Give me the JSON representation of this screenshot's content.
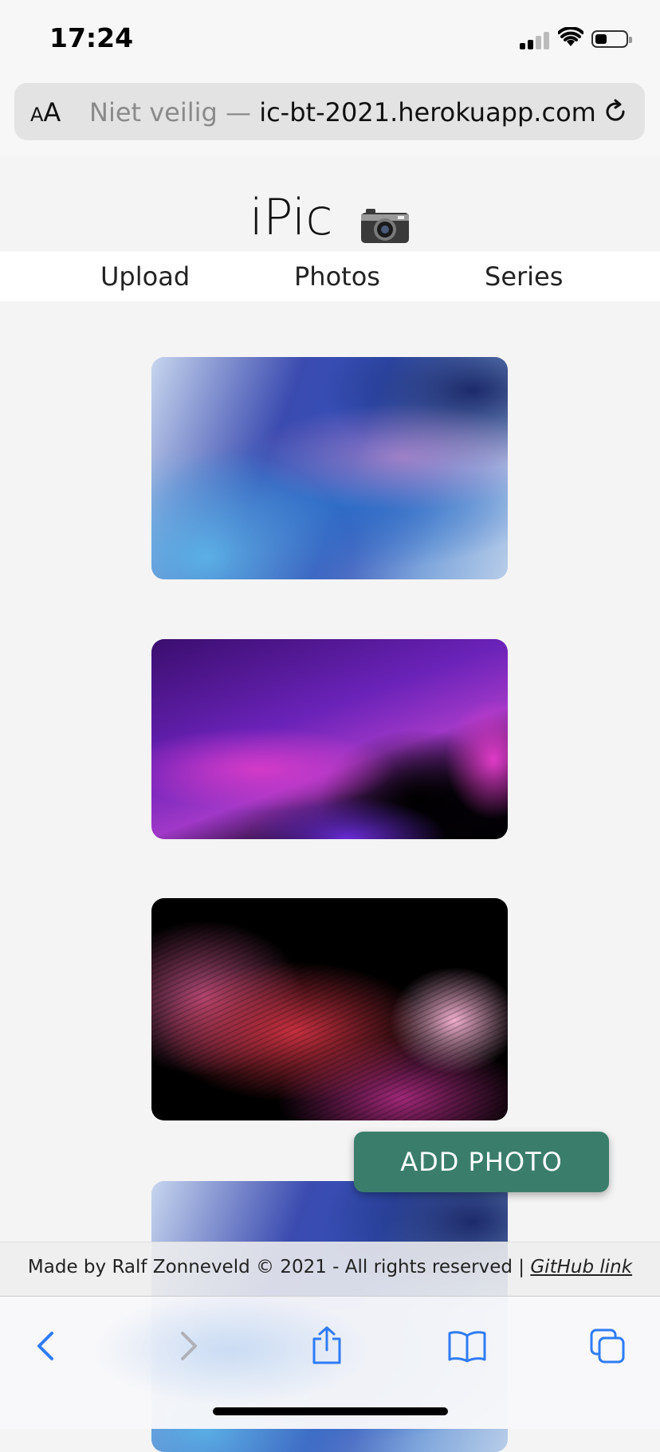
{
  "status_bar": {
    "time": "17:24",
    "battery_level": 0.4
  },
  "browser": {
    "text_size_button": "AA",
    "url_insecure_label": "Niet veilig — ",
    "url_host": "ic-bt-2021.herokuapp.com"
  },
  "site": {
    "title": "iPic",
    "nav": [
      {
        "label": "Upload"
      },
      {
        "label": "Photos"
      },
      {
        "label": "Series"
      }
    ]
  },
  "photos": [
    {
      "name": "blue-silk-wallpaper"
    },
    {
      "name": "purple-waves-wallpaper"
    },
    {
      "name": "red-flow-wallpaper"
    },
    {
      "name": "blue-silk-wallpaper"
    }
  ],
  "add_photo_button": "ADD PHOTO",
  "footer": {
    "text": "Made by Ralf Zonneveld © 2021 - All rights reserved | ",
    "link": "GitHub link"
  },
  "toolbar": {
    "icons": [
      "back-icon",
      "forward-icon",
      "share-icon",
      "bookmarks-icon",
      "tabs-icon"
    ]
  },
  "colors": {
    "accent": "#3b7d6b",
    "link_blue": "#2f7bf5"
  }
}
